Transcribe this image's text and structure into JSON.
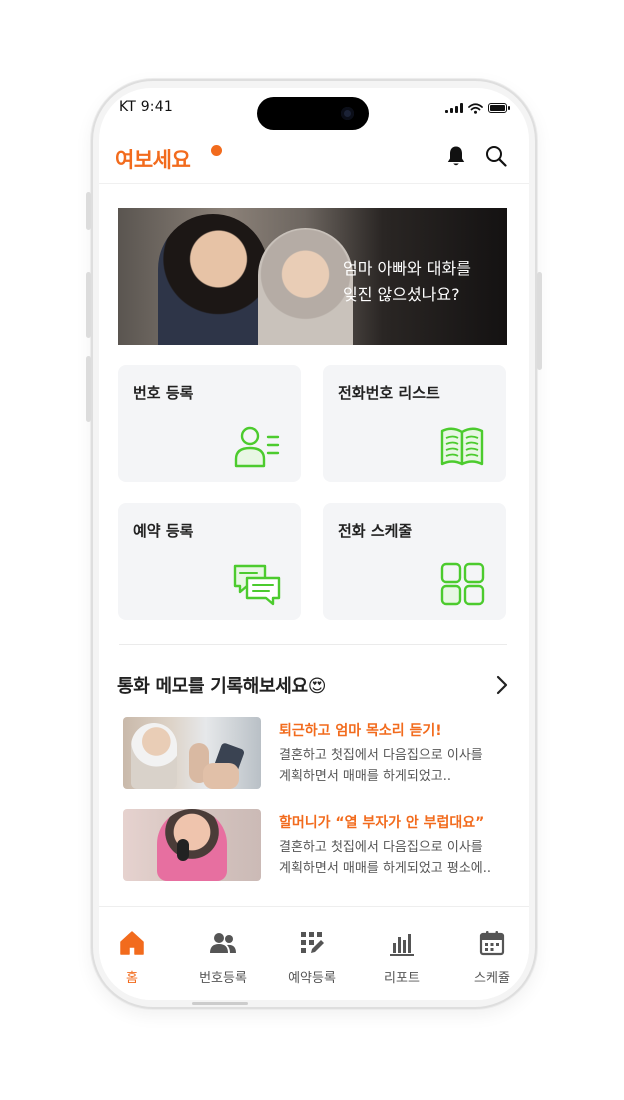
{
  "status_bar": {
    "carrier_time": "KT 9:41"
  },
  "header": {
    "logo": "여보세요"
  },
  "hero": {
    "line1": "엄마 아빠와 대화를",
    "line2": "잊진 않으셨나요?"
  },
  "menu": [
    {
      "label": "번호 등록",
      "icon": "user-list-icon"
    },
    {
      "label": "전화번호 리스트",
      "icon": "book-icon"
    },
    {
      "label": "예약 등록",
      "icon": "chat-icon"
    },
    {
      "label": "전화 스케줄",
      "icon": "grid-icon"
    }
  ],
  "memo_section": {
    "title": "통화 메모를 기록해보세요😍"
  },
  "memos": [
    {
      "title": "퇴근하고 엄마 목소리 듣기!",
      "desc_line1": "결혼하고 첫집에서 다음집으로 이사를",
      "desc_line2": "계획하면서 매매를 하게되었고.."
    },
    {
      "title": "할머니가 “열 부자가 안 부럽대요”",
      "desc_line1": "결혼하고 첫집에서 다음집으로 이사를",
      "desc_line2": "계획하면서 매매를 하게되었고 평소에.."
    }
  ],
  "tabs": [
    {
      "label": "홈",
      "icon": "home-icon",
      "active": true
    },
    {
      "label": "번호등록",
      "icon": "people-icon"
    },
    {
      "label": "예약등록",
      "icon": "edit-grid-icon"
    },
    {
      "label": "리포트",
      "icon": "bar-chart-icon"
    },
    {
      "label": "스케쥴",
      "icon": "calendar-icon"
    }
  ],
  "colors": {
    "accent": "#f26b1d",
    "icon_green": "#4ccb2e",
    "card_bg": "#f4f5f7"
  }
}
